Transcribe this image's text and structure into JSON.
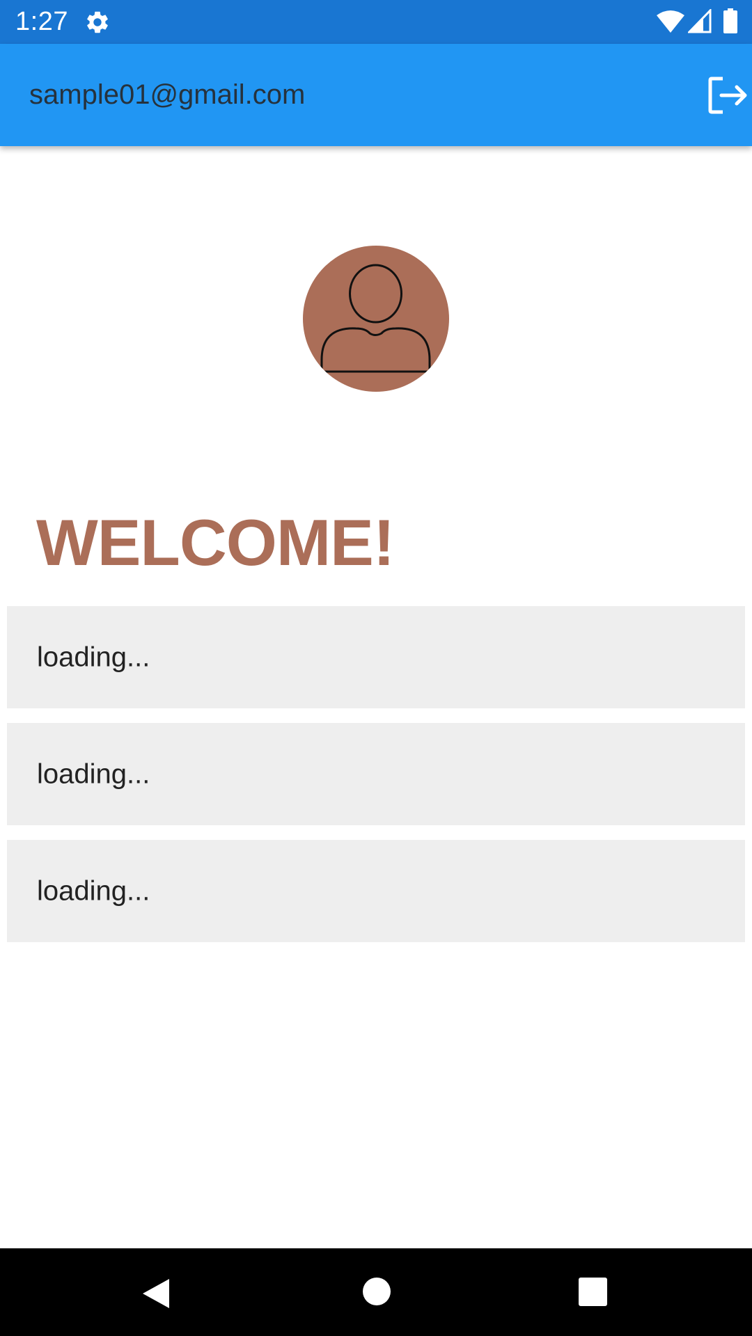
{
  "status_bar": {
    "time": "1:27",
    "icons": [
      "gear-icon",
      "wifi-icon",
      "cell-signal-icon",
      "battery-icon"
    ]
  },
  "app_bar": {
    "title": "sample01@gmail.com",
    "action_icon": "logout-icon",
    "background": "#2196f3"
  },
  "avatar": {
    "icon": "person-icon",
    "background": "#ab6e58"
  },
  "main": {
    "welcome_text": "WELCOME!",
    "welcome_color": "#ab6e58",
    "cards": [
      {
        "text": "loading..."
      },
      {
        "text": "loading..."
      },
      {
        "text": "loading..."
      }
    ]
  },
  "nav_bar": {
    "icons": [
      "back-icon",
      "home-icon",
      "recents-icon"
    ]
  }
}
